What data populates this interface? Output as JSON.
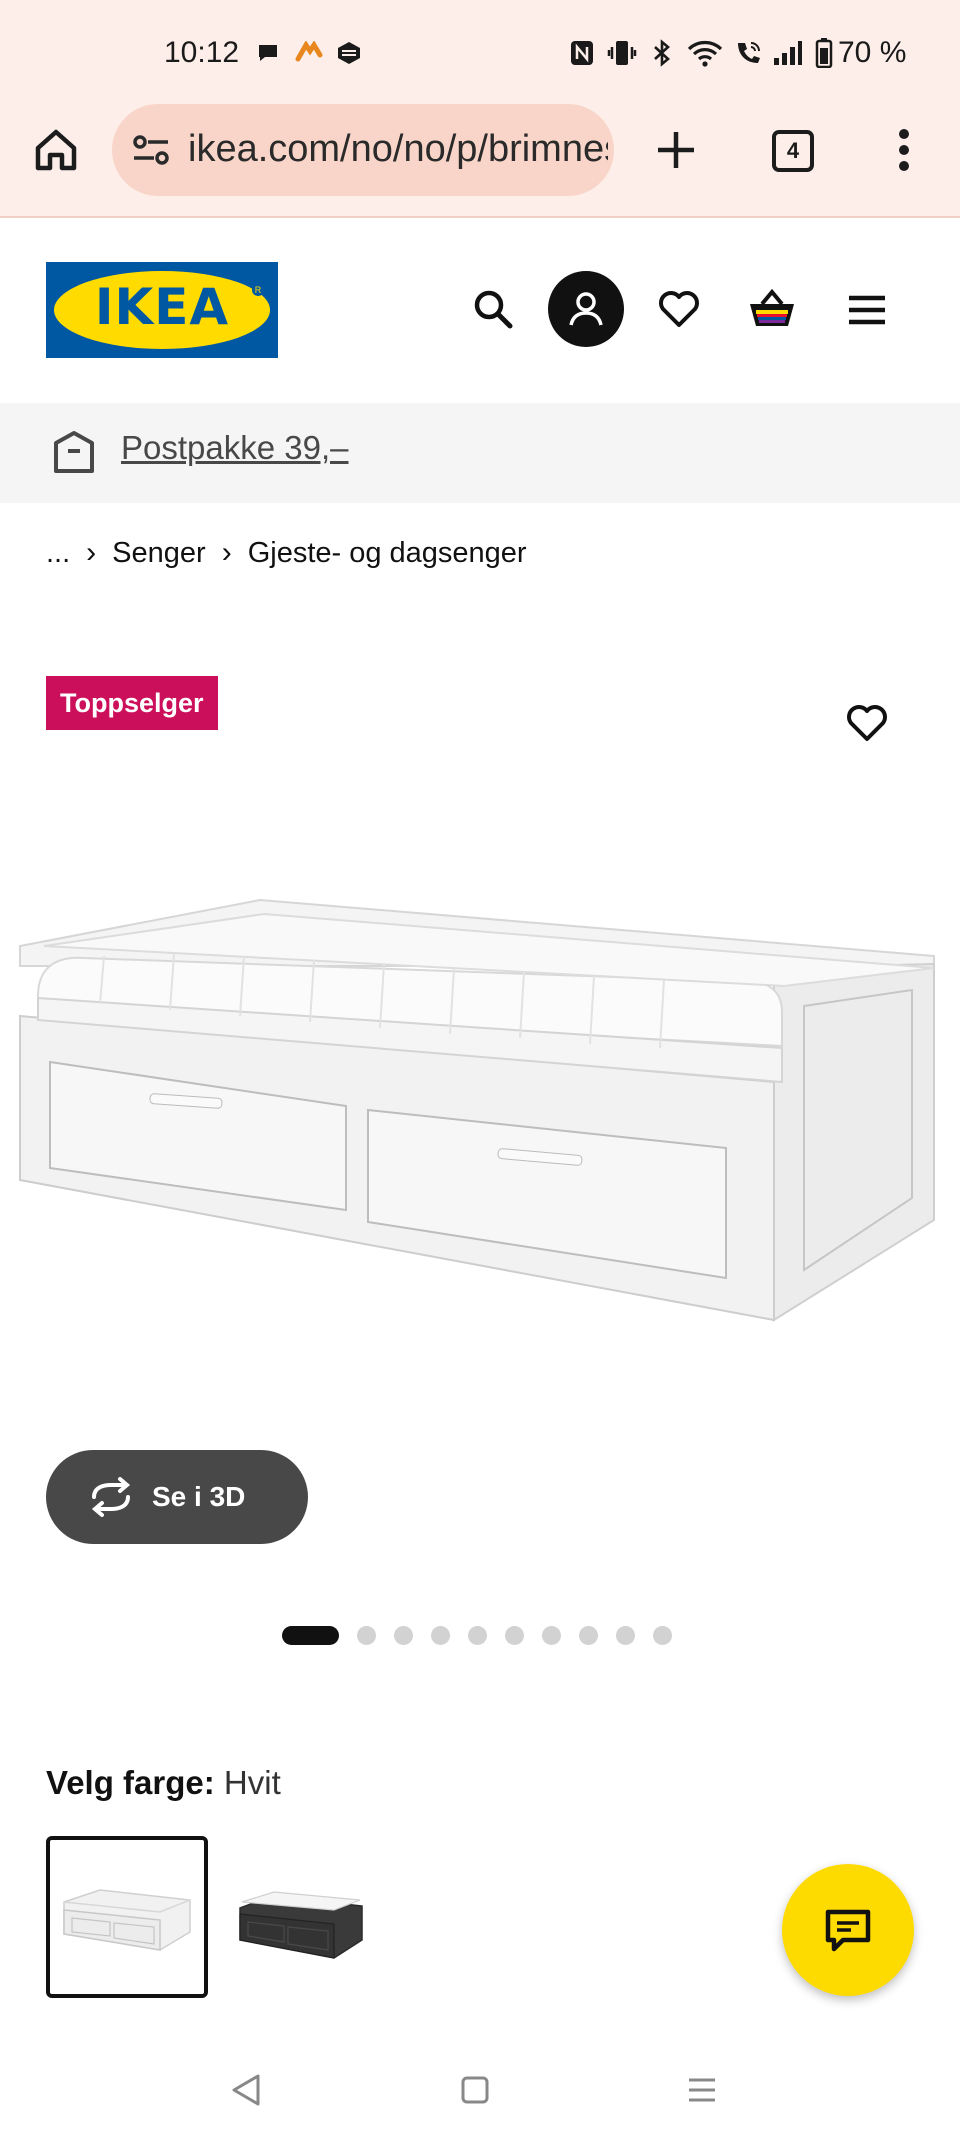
{
  "status_bar": {
    "time": "10:12",
    "battery": "70 %",
    "icons": [
      "chat-bubble-icon",
      "app-notification-icon",
      "app-notification-icon",
      "nfc-icon",
      "vibrate-icon",
      "bluetooth-icon",
      "wifi-icon",
      "wifi-calling-icon",
      "signal-icon",
      "battery-icon"
    ]
  },
  "browser": {
    "url": "ikea.com/no/no/p/brimnes-dagseng",
    "tab_count": "4",
    "icons": [
      "home-icon",
      "site-settings-icon",
      "new-tab-icon",
      "tabs-icon",
      "more-menu-icon"
    ]
  },
  "header": {
    "logo_text": "IKEA",
    "logo_colors": {
      "blue": "#0058a3",
      "yellow": "#ffdb00"
    },
    "icons": [
      "search-icon",
      "profile-icon",
      "wishlist-icon",
      "cart-icon",
      "menu-icon"
    ]
  },
  "banner": {
    "text": "Postpakke 39,–",
    "icon": "parcel-icon"
  },
  "breadcrumb": {
    "ellipsis": "...",
    "items": [
      "Senger",
      "Gjeste- og dagsenger"
    ]
  },
  "product": {
    "badge": "Toppselger",
    "badge_color": "#cc0f5a",
    "view_3d_label": "Se i 3D",
    "carousel": {
      "total": 10,
      "active": 1
    },
    "color_label": "Velg farge:",
    "color_value": "Hvit",
    "swatches": [
      {
        "name": "Hvit",
        "selected": true
      },
      {
        "name": "Svart",
        "selected": false
      }
    ]
  },
  "chat": {
    "icon": "chat-icon",
    "color": "#fddb00"
  },
  "nav_bar": {
    "icons": [
      "back-icon",
      "home-square-icon",
      "recents-icon"
    ]
  }
}
